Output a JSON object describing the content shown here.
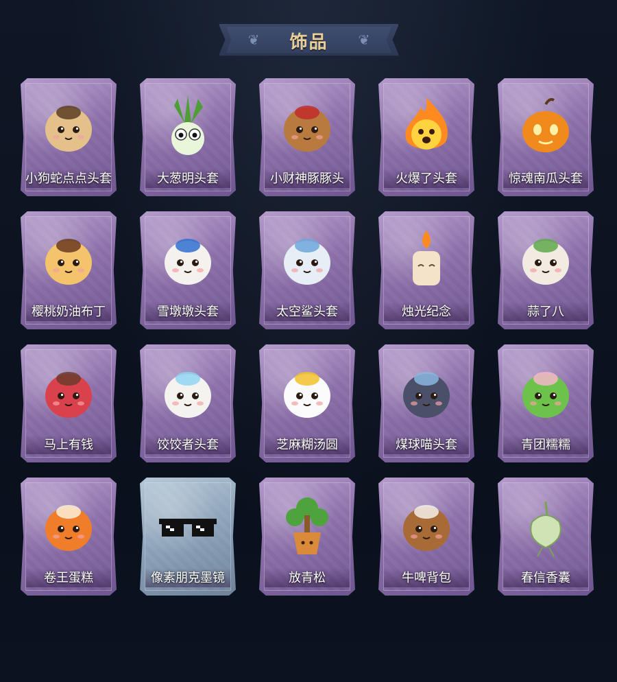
{
  "header": {
    "title": "饰品"
  },
  "items": [
    {
      "label": "小狗蛇点点头套",
      "icon": "snake-head-icon",
      "color": "#e4c08a",
      "accent": "#5c3d21",
      "style": "purple"
    },
    {
      "label": "大葱明头套",
      "icon": "scallion-icon",
      "color": "#7cc25a",
      "accent": "#e9f6d9",
      "style": "purple"
    },
    {
      "label": "小财神豚豚头",
      "icon": "capybara-fortune-icon",
      "color": "#b87a3d",
      "accent": "#c22b2b",
      "style": "purple"
    },
    {
      "label": "火爆了头套",
      "icon": "flame-icon",
      "color": "#ff8a1f",
      "accent": "#ffd23f",
      "style": "purple"
    },
    {
      "label": "惊魂南瓜头套",
      "icon": "pumpkin-icon",
      "color": "#f08a1c",
      "accent": "#fff2a8",
      "style": "purple"
    },
    {
      "label": "樱桃奶油布丁",
      "icon": "pudding-icon",
      "color": "#f3c46b",
      "accent": "#6b3a1e",
      "style": "purple"
    },
    {
      "label": "雪墩墩头套",
      "icon": "snowman-icon",
      "color": "#f4f1ee",
      "accent": "#2f6fd0",
      "style": "purple"
    },
    {
      "label": "太空鲨头套",
      "icon": "shark-icon",
      "color": "#e8eef6",
      "accent": "#6fa6d9",
      "style": "purple"
    },
    {
      "label": "烛光纪念",
      "icon": "candle-icon",
      "color": "#f4e2c9",
      "accent": "#ff8a1f",
      "style": "purple"
    },
    {
      "label": "蒜了八",
      "icon": "garlic-icon",
      "color": "#f2ebe1",
      "accent": "#5fa84a",
      "style": "purple"
    },
    {
      "label": "马上有钱",
      "icon": "horse-icon",
      "color": "#d9424d",
      "accent": "#6b3b2a",
      "style": "purple"
    },
    {
      "label": "饺饺者头套",
      "icon": "dumpling-cloud-icon",
      "color": "#f5f3ef",
      "accent": "#8fd3f2",
      "style": "purple"
    },
    {
      "label": "芝麻糊汤圆",
      "icon": "rice-ball-icon",
      "color": "#fbfbfb",
      "accent": "#f2c12e",
      "style": "purple"
    },
    {
      "label": "煤球喵头套",
      "icon": "black-cat-icon",
      "color": "#4a5068",
      "accent": "#8ab6e0",
      "style": "purple"
    },
    {
      "label": "青团糯糯",
      "icon": "green-dumpling-icon",
      "color": "#6cc24a",
      "accent": "#f7b6c9",
      "style": "purple"
    },
    {
      "label": "卷王蛋糕",
      "icon": "swiss-roll-icon",
      "color": "#f07d2a",
      "accent": "#fbeed8",
      "style": "purple"
    },
    {
      "label": "像素朋克墨镜",
      "icon": "pixel-sunglasses-icon",
      "color": "#111111",
      "accent": "#ffffff",
      "style": "blue"
    },
    {
      "label": "放青松",
      "icon": "pine-bonsai-icon",
      "color": "#4fa33e",
      "accent": "#d98a3a",
      "style": "purple"
    },
    {
      "label": "牛啤背包",
      "icon": "cow-beer-icon",
      "color": "#a86a36",
      "accent": "#f4f0ea",
      "style": "purple"
    },
    {
      "label": "春信香囊",
      "icon": "sachet-icon",
      "color": "#cfe3b4",
      "accent": "#7aa35a",
      "style": "purple"
    }
  ]
}
